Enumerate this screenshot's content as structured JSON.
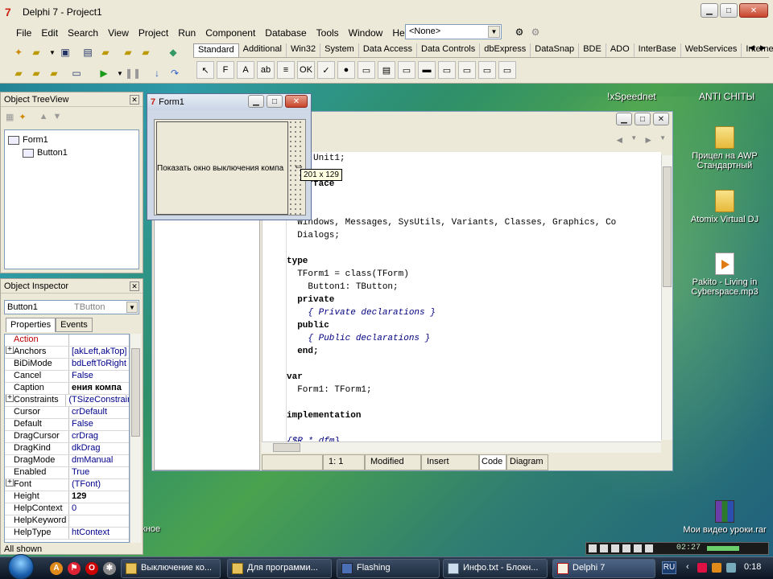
{
  "app": {
    "title": "Delphi 7 - Project1",
    "menu": [
      "File",
      "Edit",
      "Search",
      "View",
      "Project",
      "Run",
      "Component",
      "Database",
      "Tools",
      "Window",
      "Help"
    ],
    "config_combo": "<None>",
    "palette_tabs": [
      "Standard",
      "Additional",
      "Win32",
      "System",
      "Data Access",
      "Data Controls",
      "dbExpress",
      "DataSnap",
      "BDE",
      "ADO",
      "InterBase",
      "WebServices",
      "Internet"
    ],
    "palette_icons": [
      "F",
      "A",
      "ab",
      "≡",
      "OK",
      "✓",
      "●",
      "▭",
      "▤",
      "▭",
      "▬",
      "▭",
      "▭",
      "▭",
      "▭"
    ]
  },
  "tree_view": {
    "title": "Object TreeView",
    "nodes": [
      "Form1",
      "Button1"
    ]
  },
  "object_inspector": {
    "title": "Object Inspector",
    "selected_object": "Button1",
    "selected_type": "TButton",
    "tabs": [
      "Properties",
      "Events"
    ],
    "properties": [
      {
        "name": "Action",
        "value": "",
        "style": "event"
      },
      {
        "name": "Anchors",
        "value": "[akLeft,akTop]",
        "style": "plus"
      },
      {
        "name": "BiDiMode",
        "value": "bdLeftToRight",
        "style": ""
      },
      {
        "name": "Cancel",
        "value": "False",
        "style": ""
      },
      {
        "name": "Caption",
        "value": "ения компа",
        "style": "bold"
      },
      {
        "name": "Constraints",
        "value": "(TSizeConstrain",
        "style": "plus"
      },
      {
        "name": "Cursor",
        "value": "crDefault",
        "style": ""
      },
      {
        "name": "Default",
        "value": "False",
        "style": ""
      },
      {
        "name": "DragCursor",
        "value": "crDrag",
        "style": ""
      },
      {
        "name": "DragKind",
        "value": "dkDrag",
        "style": ""
      },
      {
        "name": "DragMode",
        "value": "dmManual",
        "style": ""
      },
      {
        "name": "Enabled",
        "value": "True",
        "style": ""
      },
      {
        "name": "Font",
        "value": "(TFont)",
        "style": "plus"
      },
      {
        "name": "Height",
        "value": "129",
        "style": "bold"
      },
      {
        "name": "HelpContext",
        "value": "0",
        "style": ""
      },
      {
        "name": "HelpKeyword",
        "value": "",
        "style": ""
      },
      {
        "name": "HelpType",
        "value": "htContext",
        "style": ""
      }
    ],
    "status": "All shown"
  },
  "form1": {
    "title": "Form1",
    "button_caption": "Показать окно выключения компа",
    "size_tip": "201 x 129"
  },
  "editor": {
    "code_lines": [
      {
        "t": "unit Unit1;",
        "k": "unit"
      },
      {
        "t": "",
        "k": ""
      },
      {
        "t": "interface",
        "k": "interface"
      },
      {
        "t": "",
        "k": ""
      },
      {
        "t": "uses",
        "k": "uses"
      },
      {
        "t": "  Windows, Messages, SysUtils, Variants, Classes, Graphics, Co",
        "k": ""
      },
      {
        "t": "  Dialogs;",
        "k": ""
      },
      {
        "t": "",
        "k": ""
      },
      {
        "t": "type",
        "k": "type"
      },
      {
        "t": "  TForm1 = class(TForm)",
        "k": "class"
      },
      {
        "t": "    Button1: TButton;",
        "k": ""
      },
      {
        "t": "  private",
        "k": "private"
      },
      {
        "t": "    { Private declarations }",
        "k": "comment"
      },
      {
        "t": "  public",
        "k": "public"
      },
      {
        "t": "    { Public declarations }",
        "k": "comment"
      },
      {
        "t": "  end;",
        "k": "end"
      },
      {
        "t": "",
        "k": ""
      },
      {
        "t": "var",
        "k": "var"
      },
      {
        "t": "  Form1: TForm1;",
        "k": ""
      },
      {
        "t": "",
        "k": ""
      },
      {
        "t": "implementation",
        "k": "implementation"
      },
      {
        "t": "",
        "k": ""
      },
      {
        "t": "{$R *.dfm}",
        "k": "comment"
      }
    ],
    "status": {
      "position": "1:   1",
      "modified": "Modified",
      "mode": "Insert",
      "tab_code": "Code",
      "tab_diagram": "Diagram"
    }
  },
  "desktop": {
    "label_speednet": "!xSpeednet",
    "label_anticheats": "ANTI CHITЫ",
    "icons": [
      {
        "label": "Прицел на AWP Стандартный",
        "type": "folder"
      },
      {
        "label": "Atomix Virtual DJ",
        "type": "folder"
      },
      {
        "label": "Pakito - Living in Cyberspace.mp3",
        "type": "media"
      },
      {
        "label": "Мои видео уроки.rar",
        "type": "rar"
      }
    ],
    "partial_label": "кное"
  },
  "taskbar": {
    "buttons": [
      "Выключение ко...",
      "Для программи...",
      "Flashing",
      "Инфо.txt - Блокн...",
      "Delphi 7"
    ],
    "lang": "RU",
    "time": "0:18",
    "media_time": "02:27"
  },
  "colors": {
    "window_face": "#ece9d8",
    "taskbar": "#1d2b3d",
    "keyword_color": "#000000",
    "comment_color": "#000080"
  }
}
